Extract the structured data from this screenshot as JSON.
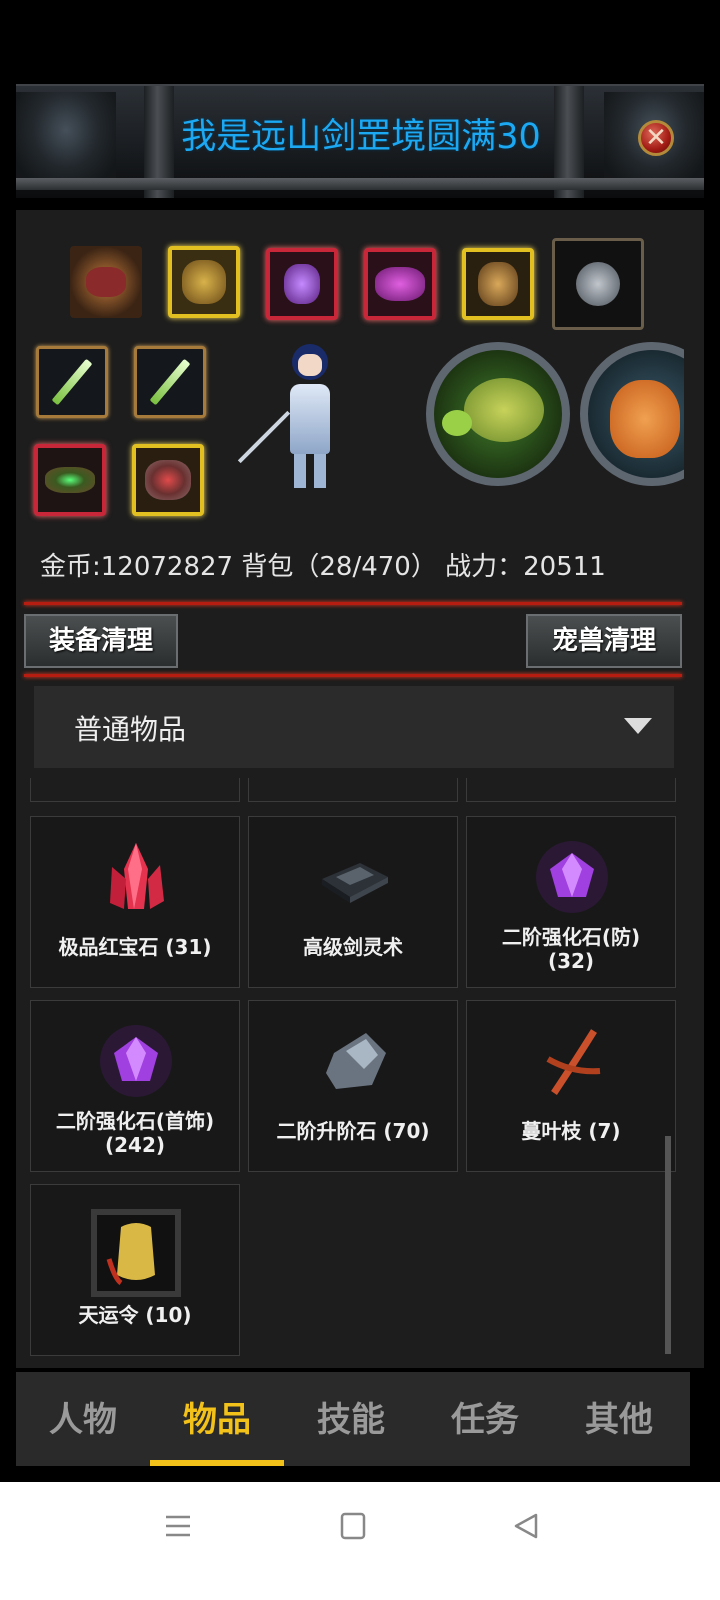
{
  "dialog": {
    "title": "我是远山剑罡境圆满30",
    "close_icon": "close-icon"
  },
  "equipment": {
    "slots": [
      {
        "name": "helmet-slot",
        "rarity": "green",
        "color": "#4caf50"
      },
      {
        "name": "armor-slot",
        "rarity": "gold",
        "color": "#e2c021"
      },
      {
        "name": "amulet-slot",
        "rarity": "red",
        "color": "#c8273a"
      },
      {
        "name": "mask-slot",
        "rarity": "red",
        "color": "#c8273a"
      },
      {
        "name": "charm-slot",
        "rarity": "gold",
        "color": "#e2c021"
      },
      {
        "name": "ring-slot",
        "rarity": "dark",
        "color": "#6a5d4a"
      },
      {
        "name": "sword-slot-1",
        "rarity": "bronze",
        "color": "#a67a3a"
      },
      {
        "name": "sword-slot-2",
        "rarity": "bronze",
        "color": "#a67a3a"
      },
      {
        "name": "belt-slot",
        "rarity": "red",
        "color": "#c8273a"
      },
      {
        "name": "bracer-slot",
        "rarity": "gold",
        "color": "#e2c021"
      }
    ],
    "pets": [
      "turtle-pet",
      "fox-pet"
    ]
  },
  "stats": {
    "text": "金币:12072827 背包（28/470） 战力：20511"
  },
  "buttons": {
    "clean_equipment": "装备清理",
    "clean_pets": "宠兽清理"
  },
  "filter": {
    "selected": "普通物品",
    "arrow_icon": "caret-down-icon"
  },
  "items": [
    {
      "name": "极品红宝石 (31)",
      "icon": "red-crystal-icon",
      "color": "#e4334f"
    },
    {
      "name": "高级剑灵术",
      "icon": "book-icon",
      "color": "#3a4047"
    },
    {
      "name": "二阶强化石(防)\n(32)",
      "icon": "purple-gem-icon",
      "color": "#a040e0"
    },
    {
      "name": "二阶强化石(首饰)\n(242)",
      "icon": "purple-gem-icon",
      "color": "#a040e0"
    },
    {
      "name": "二阶升阶石 (70)",
      "icon": "grey-stone-icon",
      "color": "#7e8a99"
    },
    {
      "name": "蔓叶枝 (7)",
      "icon": "branch-icon",
      "color": "#c9502a"
    },
    {
      "name": "天运令 (10)",
      "icon": "token-icon",
      "color": "#d9b846"
    }
  ],
  "tabs": [
    {
      "label": "人物",
      "active": false
    },
    {
      "label": "物品",
      "active": true
    },
    {
      "label": "技能",
      "active": false
    },
    {
      "label": "任务",
      "active": false
    },
    {
      "label": "其他",
      "active": false
    }
  ],
  "system_nav": {
    "menu_icon": "menu-icon",
    "home_icon": "home-icon",
    "back_icon": "back-icon"
  }
}
